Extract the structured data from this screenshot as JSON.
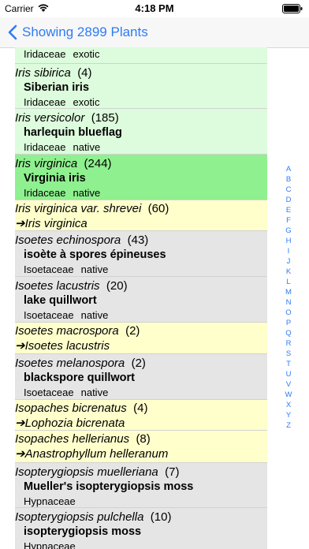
{
  "status_bar": {
    "carrier": "Carrier",
    "time": "4:18 PM",
    "wifi_icon": "wifi-icon",
    "battery_icon": "battery-icon"
  },
  "nav": {
    "back_label": "Showing 2899 Plants",
    "accent_color": "#2f7bf5"
  },
  "colors": {
    "native_bg": "#ddfbdd",
    "selected_bg": "#8ff08f",
    "synonym_bg": "#ffffcc",
    "other_bg": "#e5e5e5"
  },
  "rows": [
    {
      "kind": "partial",
      "family": "Iridaceae",
      "status": "exotic"
    },
    {
      "kind": "native",
      "scientific": "Iris sibirica",
      "count": "(4)",
      "common": "Siberian iris",
      "family": "Iridaceae",
      "status": "exotic"
    },
    {
      "kind": "native",
      "scientific": "Iris versicolor",
      "count": "(185)",
      "common": "harlequin blueflag",
      "family": "Iridaceae",
      "status": "native"
    },
    {
      "kind": "selected",
      "scientific": "Iris virginica",
      "count": "(244)",
      "common": "Virginia iris",
      "family": "Iridaceae",
      "status": "native"
    },
    {
      "kind": "synonym",
      "scientific": "Iris virginica var. shrevei",
      "count": "(60)",
      "synonym_of": "➔Iris virginica"
    },
    {
      "kind": "other",
      "scientific": "Isoetes echinospora",
      "count": "(43)",
      "common": "isoète à spores épineuses",
      "family": "Isoetaceae",
      "status": "native"
    },
    {
      "kind": "other",
      "scientific": "Isoetes lacustris",
      "count": "(20)",
      "common": "lake quillwort",
      "family": "Isoetaceae",
      "status": "native"
    },
    {
      "kind": "synonym",
      "scientific": "Isoetes macrospora",
      "count": "(2)",
      "synonym_of": "➔Isoetes lacustris"
    },
    {
      "kind": "other",
      "scientific": "Isoetes melanospora",
      "count": "(2)",
      "common": "blackspore quillwort",
      "family": "Isoetaceae",
      "status": "native"
    },
    {
      "kind": "synonym",
      "scientific": "Isopaches bicrenatus",
      "count": "(4)",
      "synonym_of": "➔Lophozia bicrenata"
    },
    {
      "kind": "synonym",
      "scientific": "Isopaches hellerianus",
      "count": "(8)",
      "synonym_of": "➔Anastrophyllum helleranum"
    },
    {
      "kind": "other",
      "scientific": "Isopterygiopsis muelleriana",
      "count": "(7)",
      "common": "Mueller's isopterygiopsis moss",
      "family": "Hypnaceae",
      "status": ""
    },
    {
      "kind": "other",
      "scientific": "Isopterygiopsis pulchella",
      "count": "(10)",
      "common": "isopterygiopsis moss",
      "family": "Hypnaceae",
      "status": ""
    }
  ],
  "index_letters": [
    "A",
    "B",
    "C",
    "D",
    "E",
    "F",
    "G",
    "H",
    "I",
    "J",
    "K",
    "L",
    "M",
    "N",
    "O",
    "P",
    "Q",
    "R",
    "S",
    "T",
    "U",
    "V",
    "W",
    "X",
    "Y",
    "Z"
  ]
}
